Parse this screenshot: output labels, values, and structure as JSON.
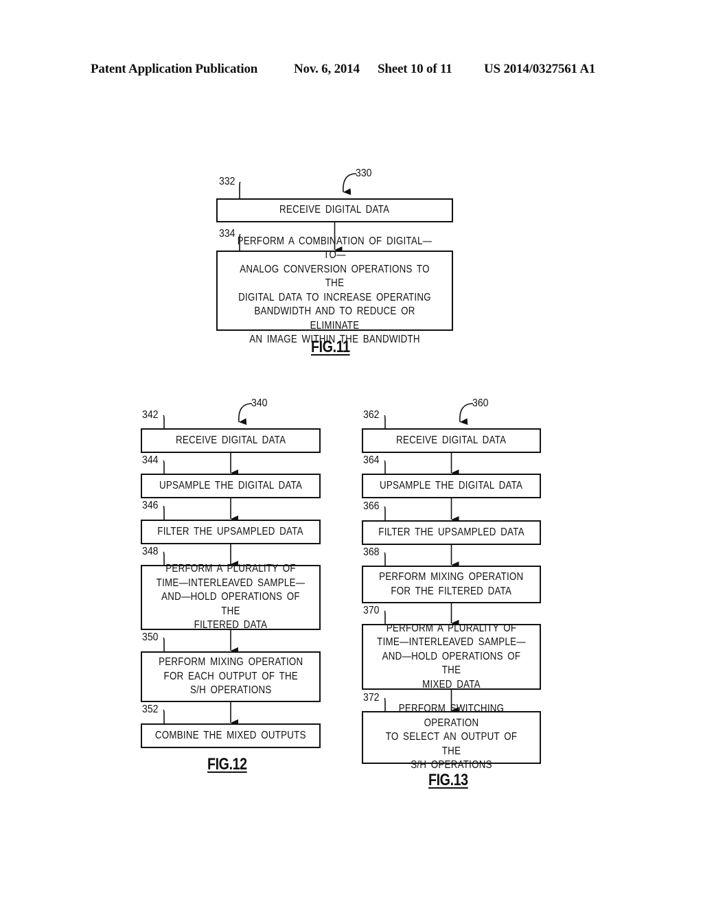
{
  "header": {
    "publication": "Patent Application Publication",
    "date": "Nov. 6, 2014",
    "sheet": "Sheet 10 of 11",
    "number": "US 2014/0327561 A1"
  },
  "figures": [
    {
      "label": "FIG.11",
      "ref": "330",
      "steps": [
        {
          "ref": "332",
          "text": "RECEIVE  DIGITAL  DATA"
        },
        {
          "ref": "334",
          "text": "PERFORM  A  COMBINATION  OF  DIGITAL—TO—\nANALOG  CONVERSION  OPERATIONS  TO  THE\nDIGITAL  DATA  TO  INCREASE  OPERATING\nBANDWIDTH  AND  TO  REDUCE  OR  ELIMINATE\nAN  IMAGE  WITHIN  THE  BANDWIDTH"
        }
      ]
    },
    {
      "label": "FIG.12",
      "ref": "340",
      "steps": [
        {
          "ref": "342",
          "text": "RECEIVE  DIGITAL  DATA"
        },
        {
          "ref": "344",
          "text": "UPSAMPLE  THE  DIGITAL  DATA"
        },
        {
          "ref": "346",
          "text": "FILTER  THE  UPSAMPLED  DATA"
        },
        {
          "ref": "348",
          "text": "PERFORM  A  PLURALITY  OF\nTIME—INTERLEAVED  SAMPLE—\nAND—HOLD  OPERATIONS  OF  THE\nFILTERED  DATA"
        },
        {
          "ref": "350",
          "text": "PERFORM  MIXING  OPERATION\nFOR  EACH  OUTPUT  OF  THE\nS/H  OPERATIONS"
        },
        {
          "ref": "352",
          "text": "COMBINE  THE  MIXED  OUTPUTS"
        }
      ]
    },
    {
      "label": "FIG.13",
      "ref": "360",
      "steps": [
        {
          "ref": "362",
          "text": "RECEIVE  DIGITAL  DATA"
        },
        {
          "ref": "364",
          "text": "UPSAMPLE  THE  DIGITAL  DATA"
        },
        {
          "ref": "366",
          "text": "FILTER  THE  UPSAMPLED  DATA"
        },
        {
          "ref": "368",
          "text": "PERFORM  MIXING  OPERATION\nFOR  THE  FILTERED  DATA"
        },
        {
          "ref": "370",
          "text": "PERFORM  A  PLURALITY  OF\nTIME—INTERLEAVED  SAMPLE—\nAND—HOLD  OPERATIONS  OF  THE\nMIXED  DATA"
        },
        {
          "ref": "372",
          "text": "PERFORM  SWITCHING  OPERATION\nTO  SELECT  AN  OUTPUT  OF  THE\nS/H  OPERATIONS"
        }
      ]
    }
  ]
}
